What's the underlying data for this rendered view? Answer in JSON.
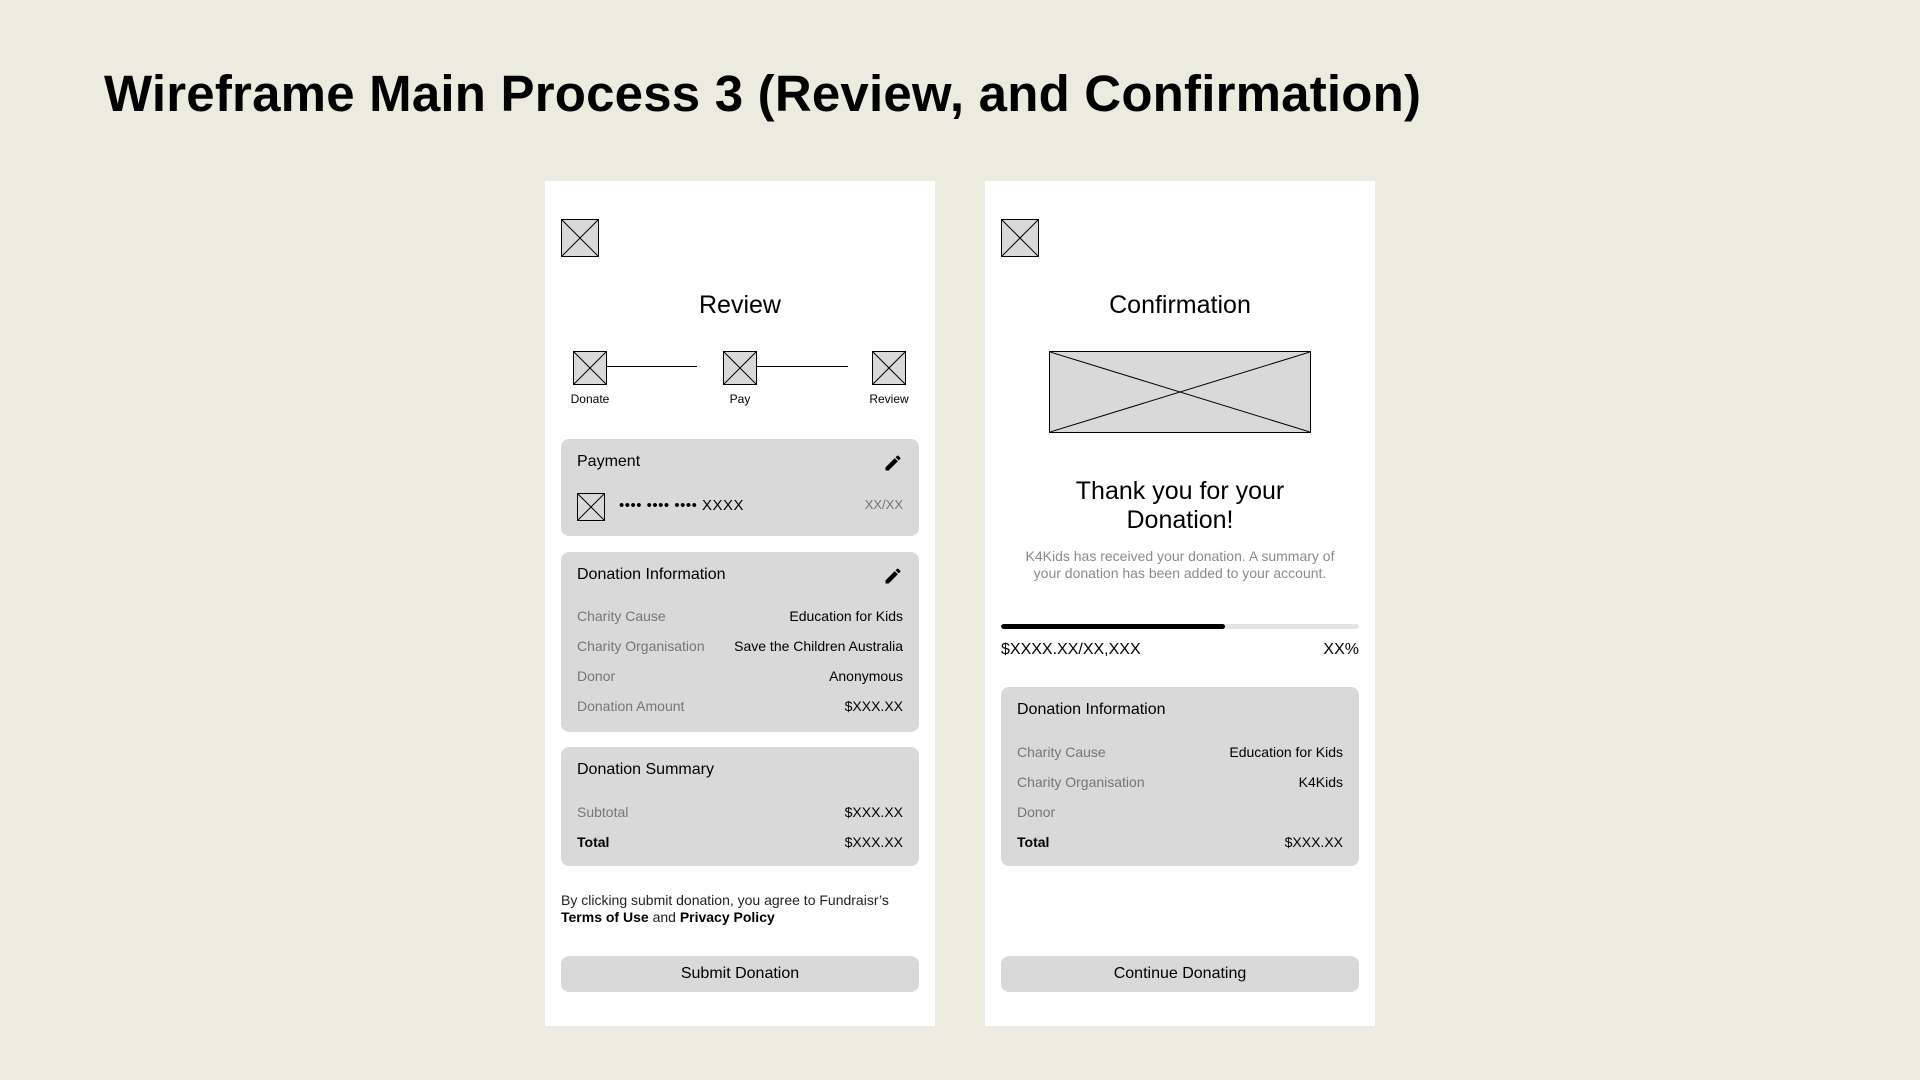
{
  "page": {
    "title": "Wireframe Main Process 3 (Review, and Confirmation)"
  },
  "review": {
    "heading": "Review",
    "steps": [
      {
        "label": "Donate"
      },
      {
        "label": "Pay"
      },
      {
        "label": "Review"
      }
    ],
    "payment": {
      "title": "Payment",
      "card_number": "•••• •••• •••• XXXX",
      "expiry": "XX/XX"
    },
    "donation_info": {
      "title": "Donation Information",
      "rows": [
        {
          "label": "Charity Cause",
          "value": "Education for Kids"
        },
        {
          "label": "Charity Organisation",
          "value": "Save the Children Australia"
        },
        {
          "label": "Donor",
          "value": "Anonymous"
        },
        {
          "label": "Donation Amount",
          "value": "$XXX.XX"
        }
      ]
    },
    "donation_summary": {
      "title": "Donation Summary",
      "rows": [
        {
          "label": "Subtotal",
          "value": "$XXX.XX"
        },
        {
          "label": "Total",
          "value": "$XXX.XX"
        }
      ]
    },
    "legal": {
      "prefix": "By clicking submit donation, you agree to Fundraisr’s",
      "terms": "Terms of Use",
      "and": "and",
      "privacy": "Privacy Policy"
    },
    "submit_label": "Submit Donation"
  },
  "confirmation": {
    "heading": "Confirmation",
    "thanks_line1": "Thank you for your",
    "thanks_line2": "Donation!",
    "summary_text": "K4Kids has received your donation. A summary of your donation has been added to your account.",
    "progress": {
      "fraction": 0.625,
      "amount": "$XXXX.XX/XX,XXX",
      "percent": "XX%"
    },
    "donation_info": {
      "title": "Donation Information",
      "rows": [
        {
          "label": "Charity Cause",
          "value": "Education for Kids"
        },
        {
          "label": "Charity Organisation",
          "value": "K4Kids"
        },
        {
          "label": "Donor",
          "value": ""
        },
        {
          "label": "Total",
          "value": "$XXX.XX"
        }
      ]
    },
    "continue_label": "Continue Donating"
  }
}
